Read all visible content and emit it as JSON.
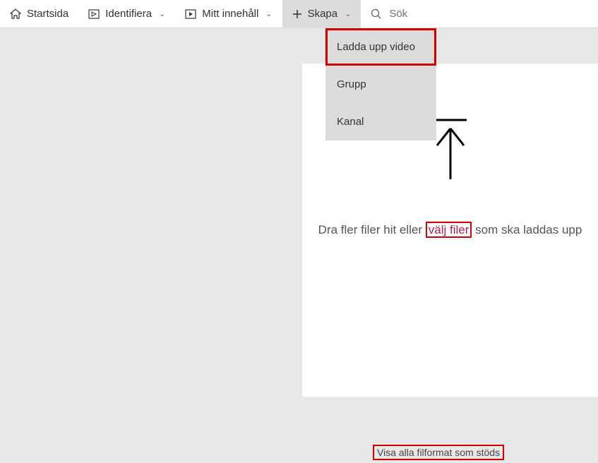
{
  "nav": {
    "home": "Startsida",
    "identify": "Identifiera",
    "content": "Mitt innehåll",
    "create": "Skapa"
  },
  "search": {
    "placeholder": "Sök"
  },
  "dropdown": {
    "upload_video": "Ladda upp video",
    "group": "Grupp",
    "channel": "Kanal"
  },
  "upload": {
    "text_before": "Dra fler filer hit eller ",
    "select_files": "välj filer",
    "text_after": " som ska laddas upp"
  },
  "footer": {
    "supported_formats": "Visa alla filformat som stöds"
  }
}
